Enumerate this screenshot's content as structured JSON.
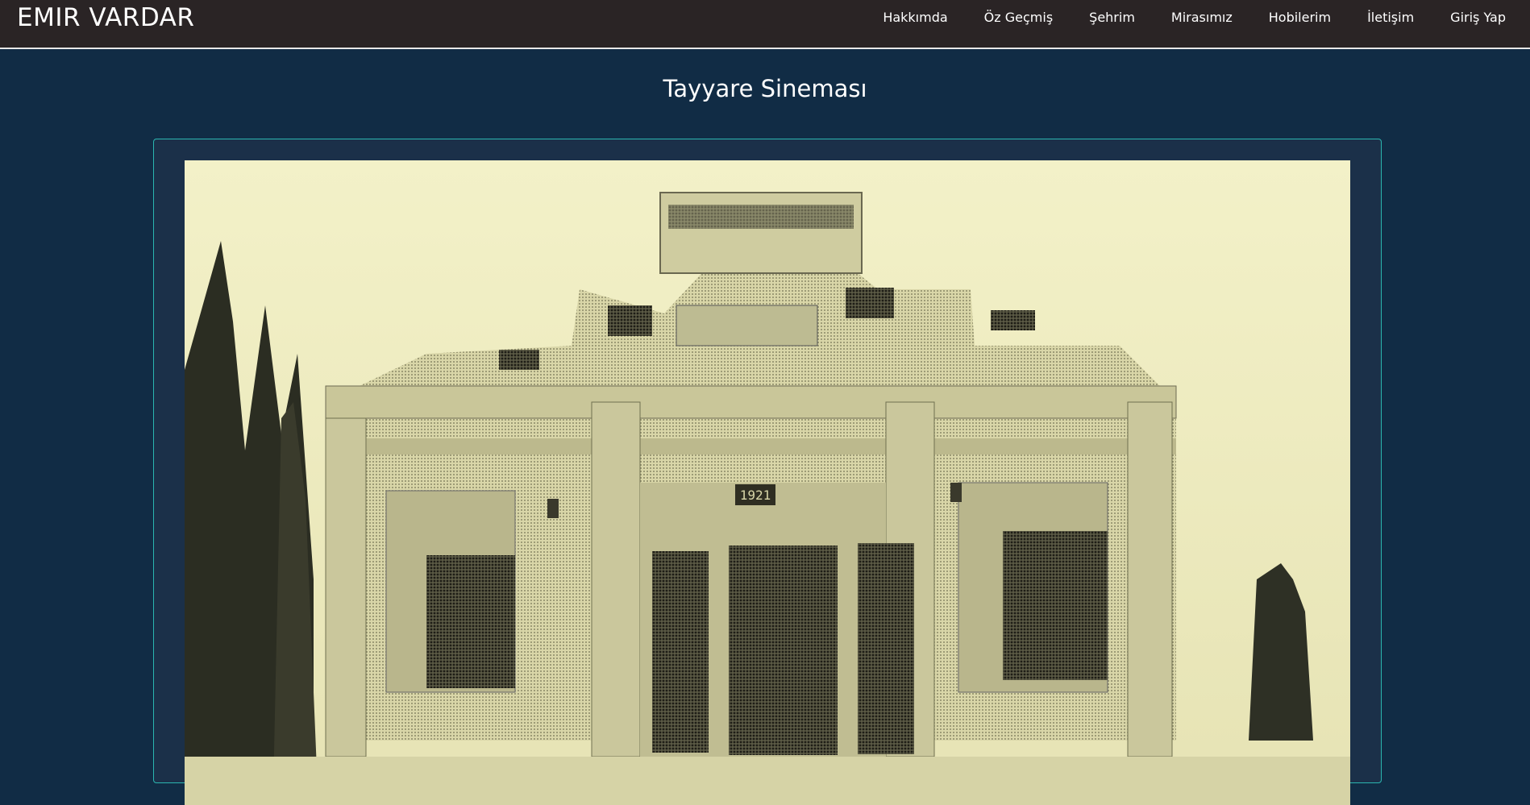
{
  "header": {
    "brand": "EMIR VARDAR",
    "nav": [
      {
        "label": "Hakkımda"
      },
      {
        "label": "Öz Geçmiş"
      },
      {
        "label": "Şehrim"
      },
      {
        "label": "Mirasımız"
      },
      {
        "label": "Hobilerim"
      },
      {
        "label": "İletişim"
      },
      {
        "label": "Giriş Yap"
      }
    ]
  },
  "main": {
    "title": "Tayyare Sineması",
    "photo": {
      "subject": "historic-cinema-building-photo",
      "year_plaque": "1921"
    }
  },
  "colors": {
    "navbar_bg": "#2a2425",
    "page_bg": "#112c45",
    "frame_border": "#2bb6b0",
    "text": "#ffffff"
  }
}
